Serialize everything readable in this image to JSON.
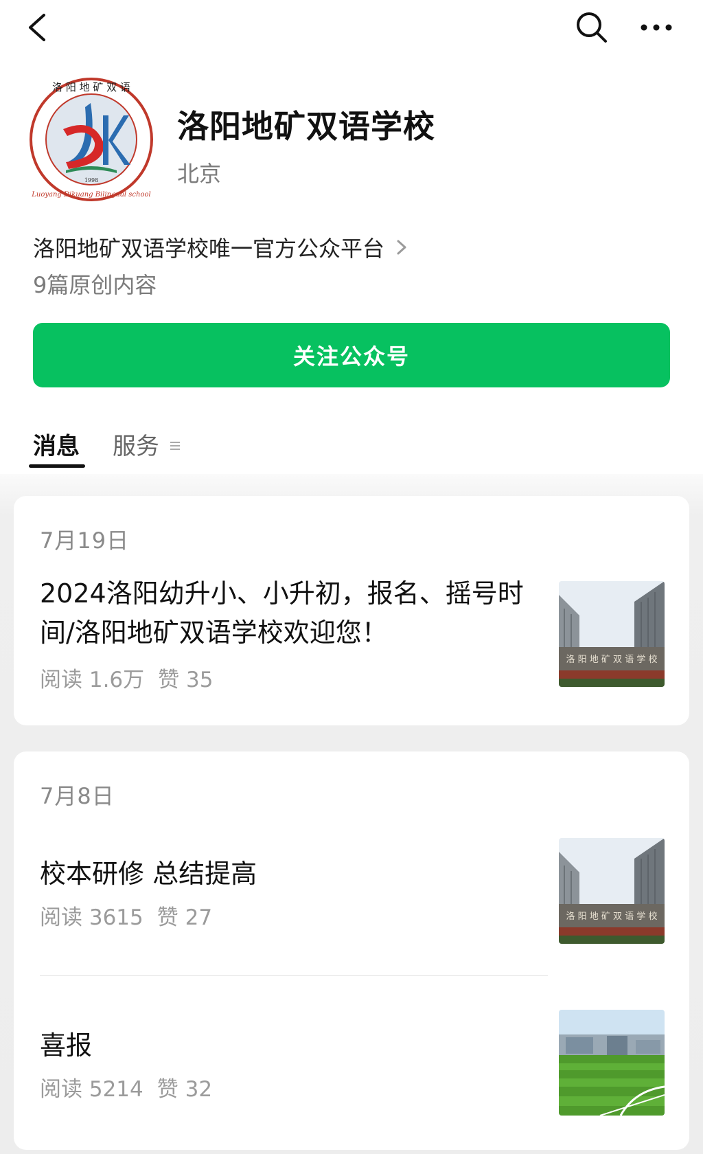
{
  "account": {
    "name": "洛阳地矿双语学校",
    "location": "北京",
    "description": "洛阳地矿双语学校唯一官方公众平台",
    "original_count": "9篇原创内容",
    "follow_label": "关注公众号",
    "logo_text": "洛阳地矿双语学校 Luoyang Dikuang Bilingual school 1998"
  },
  "tabs": {
    "messages": "消息",
    "services": "服务"
  },
  "icons": {
    "back": "back-arrow-icon",
    "search": "search-icon",
    "more": "more-dots-icon",
    "chevron": "chevron-right-icon",
    "menu": "menu-lines-icon"
  },
  "colors": {
    "accent": "#07c160"
  },
  "feed": [
    {
      "date": "7月19日",
      "articles": [
        {
          "title": "2024洛阳幼升小、小升初，报名、摇号时间/洛阳地矿双语学校欢迎您！",
          "reads": "阅读 1.6万",
          "likes": "赞 35",
          "thumb": "school-gate-photo"
        }
      ]
    },
    {
      "date": "7月8日",
      "articles": [
        {
          "title": "校本研修  总结提高",
          "reads": "阅读 3615",
          "likes": "赞 27",
          "thumb": "school-gate-photo"
        },
        {
          "title": "喜报",
          "reads": "阅读 5214",
          "likes": "赞 32",
          "thumb": "sports-field-photo"
        }
      ]
    }
  ]
}
